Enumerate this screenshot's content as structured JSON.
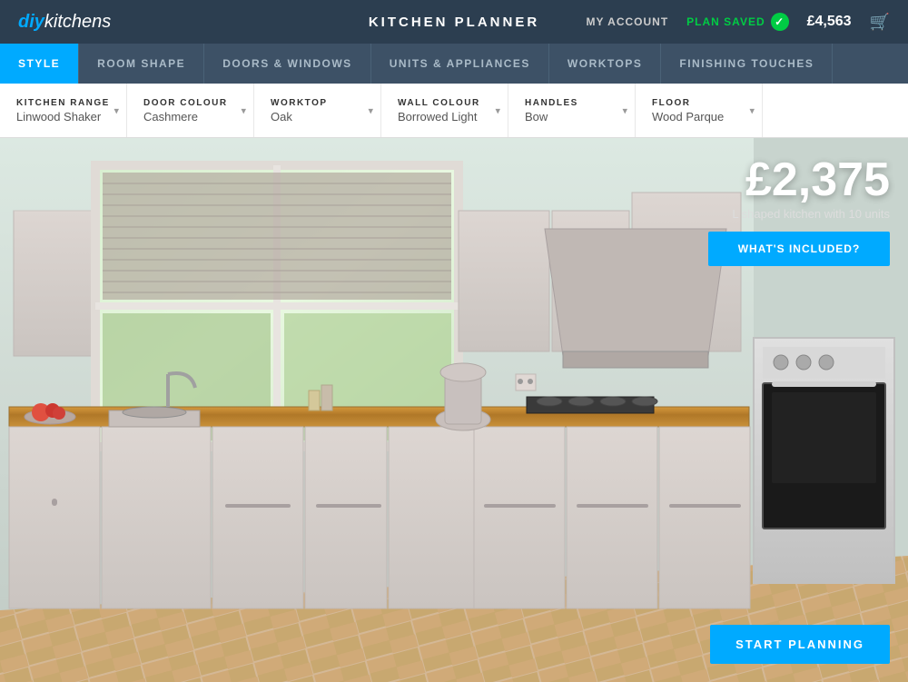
{
  "logo": {
    "diy": "diy",
    "kitchens": "kitchens"
  },
  "topnav": {
    "title": "KITCHEN PLANNER",
    "my_account": "MY ACCOUNT",
    "plan_saved": "PLAN SAVED",
    "price": "£4,563"
  },
  "secnav": {
    "items": [
      {
        "label": "STYLE",
        "active": true
      },
      {
        "label": "ROOM SHAPE",
        "active": false
      },
      {
        "label": "DOORS & WINDOWS",
        "active": false
      },
      {
        "label": "UNITS & APPLIANCES",
        "active": false
      },
      {
        "label": "WORKTOPS",
        "active": false
      },
      {
        "label": "FINISHING TOUCHES",
        "active": false
      }
    ]
  },
  "toolbar": {
    "items": [
      {
        "label": "KITCHEN RANGE",
        "value": "Linwood Shaker"
      },
      {
        "label": "DOOR COLOUR",
        "value": "Cashmere"
      },
      {
        "label": "WORKTOP",
        "value": "Oak"
      },
      {
        "label": "WALL COLOUR",
        "value": "Borrowed Light"
      },
      {
        "label": "HANDLES",
        "value": "Bow"
      },
      {
        "label": "FLOOR",
        "value": "Wood Parque"
      }
    ]
  },
  "scene": {
    "price": "£2,375",
    "description": "L shaped kitchen with 10 units",
    "whats_included": "WHAT'S INCLUDED?",
    "start_planning": "START PLANNING"
  },
  "colors": {
    "accent": "#00aaff",
    "nav_bg": "#2c3e50",
    "sec_nav_bg": "#3d5166",
    "cabinet_color": "#d5ccc8",
    "worktop_color": "#c8903a"
  }
}
